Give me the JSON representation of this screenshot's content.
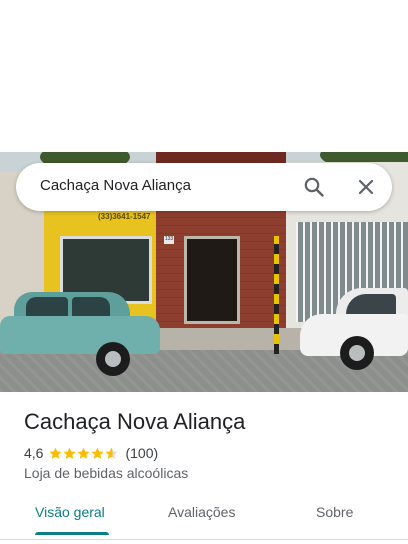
{
  "search": {
    "query": "Cachaça Nova Aliança",
    "icons": [
      "search-icon",
      "close-icon"
    ]
  },
  "photo": {
    "shop_sign": "(33)3641-1547",
    "house_number": "133"
  },
  "place": {
    "name": "Cachaça Nova Aliança",
    "rating": "4,6",
    "rating_value": 4.6,
    "rating_max": 5,
    "review_count": "(100)",
    "category": "Loja de bebidas alcoólicas"
  },
  "tabs": [
    {
      "label": "Visão geral",
      "active": true
    },
    {
      "label": "Avaliações",
      "active": false
    },
    {
      "label": "Sobre",
      "active": false
    }
  ],
  "colors": {
    "accent": "#0b7d88",
    "star": "#fbbc04",
    "text_primary": "#202124",
    "text_secondary": "#5f6368"
  }
}
